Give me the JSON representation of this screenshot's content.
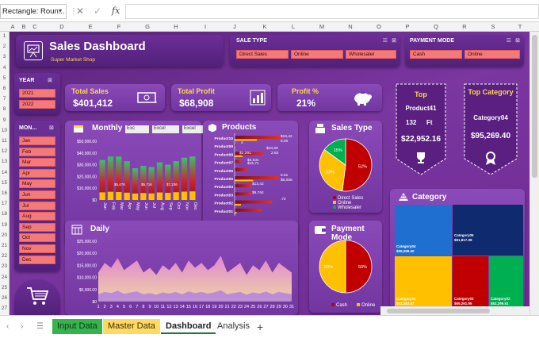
{
  "formula_bar": {
    "name_box": "Rectangle: Roun...",
    "fx": "fx",
    "cancel": "✕",
    "enter": "✓"
  },
  "columns": [
    "A",
    "B",
    "C",
    "D",
    "E",
    "F",
    "G",
    "H",
    "I",
    "J",
    "K",
    "L",
    "M",
    "N",
    "O",
    "P",
    "Q",
    "R",
    "S",
    "T"
  ],
  "rows": [
    "1",
    "2",
    "3",
    "4",
    "5",
    "6",
    "7",
    "8",
    "9",
    "10",
    "11",
    "12",
    "13",
    "14",
    "15",
    "16",
    "17",
    "18",
    "19",
    "20",
    "21",
    "22",
    "23",
    "24",
    "25",
    "26",
    "27"
  ],
  "header": {
    "title": "Sales Dashboard",
    "subtitle": "Super Market Shop"
  },
  "sale_type": {
    "title": "SALE TYPE",
    "items": [
      "Direct Sales",
      "Online",
      "Wholesaler"
    ]
  },
  "payment_mode_slicer": {
    "title": "PAYMENT MODE",
    "items": [
      "Cash",
      "Online"
    ]
  },
  "year": {
    "title": "YEAR",
    "items": [
      "2021",
      "2022"
    ]
  },
  "month": {
    "title": "MON...",
    "items": [
      "Jan",
      "Feb",
      "Mar",
      "Apr",
      "May",
      "Jun",
      "Jul",
      "Aug",
      "Sep",
      "Oct",
      "Nov",
      "Dec"
    ]
  },
  "kpis": {
    "total_sales": {
      "label": "Total Sales",
      "value": "$401,412"
    },
    "total_profit": {
      "label": "Total Profit",
      "value": "$68,908"
    },
    "profit_pct": {
      "label": "Profit %",
      "value": "21%"
    }
  },
  "top_product": {
    "title": "Top",
    "name": "Product41",
    "qty": "132",
    "unit": "Ft",
    "value": "$22,952.16"
  },
  "top_category": {
    "title": "Top Category",
    "name": "Category04",
    "value": "$95,269.40"
  },
  "monthly": {
    "title": "Monthly",
    "tabs": [
      "Exc",
      "Excel",
      "Excel"
    ]
  },
  "products": {
    "title": "Products"
  },
  "sales_type": {
    "title": "Sales Type"
  },
  "payment_mode": {
    "title": "Payment Mode"
  },
  "daily": {
    "title": "Daily"
  },
  "category": {
    "title": "Category"
  },
  "tabs": {
    "input": "Input Data",
    "master": "Master Data",
    "dashboard": "Dashboard",
    "analysis": "Analysis",
    "add": "+"
  },
  "chart_data": [
    {
      "type": "bar",
      "title": "Monthly",
      "categories": [
        "Jan",
        "Feb",
        "Mar",
        "Apr",
        "May",
        "Jun",
        "Jul",
        "Aug",
        "Sep",
        "Oct",
        "Nov",
        "Dec"
      ],
      "ylim": [
        0,
        50000
      ],
      "yticks": [
        "$0",
        "$10,000.00",
        "$20,000.00",
        "$30,000.00",
        "$40,000.00",
        "$50,000.00"
      ],
      "series": [
        {
          "name": "Sales",
          "values": [
            34000,
            37000,
            37000,
            33000,
            27000,
            29000,
            28000,
            32000,
            30000,
            33000,
            36000,
            37000
          ]
        },
        {
          "name": "Profit",
          "values": [
            6500,
            7000,
            6800,
            6200,
            5500,
            5900,
            5600,
            6400,
            6100,
            6600,
            7100,
            7300
          ]
        }
      ],
      "data_labels": [
        "$5,476",
        "$5,716",
        "$7,236"
      ]
    },
    {
      "type": "bar",
      "title": "Products",
      "orientation": "horizontal",
      "categories": [
        "Product10",
        "Product09",
        "Product08",
        "Product07",
        "Product06",
        "Product05",
        "Product04",
        "Product03",
        "Product02",
        "Product01"
      ],
      "series": [
        {
          "name": "Sales",
          "values": [
            16420,
            600,
            10500,
            2291,
            4531,
            15710,
            6056,
            6000,
            13420,
            9764
          ]
        },
        {
          "name": "Profit",
          "values": [
            8000,
            4,
            2820,
            0,
            0,
            6610,
            0,
            0,
            2270,
            720
          ]
        }
      ],
      "data_labels": [
        "$16,42",
        "8.00",
        "4",
        "$10,50",
        "2.82",
        "$2,291",
        "$4,531",
        "$15,71",
        "6.61",
        "$6,056",
        "$13,42",
        "$9,764",
        ".72"
      ]
    },
    {
      "type": "pie",
      "title": "Sales Type",
      "categories": [
        "Direct Sales",
        "Online",
        "Wholesaler"
      ],
      "values": [
        52,
        33,
        15
      ],
      "labels": [
        "52%",
        "33%",
        "15%"
      ],
      "colors": [
        "#c00000",
        "#ffc000",
        "#00b050"
      ]
    },
    {
      "type": "pie",
      "title": "Payment Mode",
      "categories": [
        "Cash",
        "Online"
      ],
      "values": [
        50,
        50
      ],
      "labels": [
        "50%",
        "50%"
      ],
      "colors": [
        "#c00000",
        "#ffc000"
      ]
    },
    {
      "type": "area",
      "title": "Daily",
      "x": [
        1,
        2,
        3,
        4,
        5,
        6,
        7,
        8,
        9,
        10,
        11,
        12,
        13,
        14,
        15,
        16,
        17,
        18,
        19,
        20,
        21,
        22,
        23,
        24,
        25,
        26,
        27,
        28,
        29,
        30,
        31
      ],
      "ylim": [
        0,
        25000
      ],
      "yticks": [
        "$0",
        "$5,000.00",
        "$10,000.00",
        "$15,000.00",
        "$20,000.00",
        "$25,000.00"
      ],
      "series": [
        {
          "name": "Sales",
          "values": [
            12000,
            16000,
            14000,
            18000,
            13000,
            15000,
            17000,
            12000,
            14000,
            11000,
            15000,
            13000,
            16000,
            12000,
            17000,
            14000,
            16000,
            13000,
            15000,
            19000,
            12000,
            14000,
            16000,
            11000,
            15000,
            13000,
            17000,
            12000,
            16000,
            14000,
            12000
          ]
        },
        {
          "name": "Profit",
          "values": [
            3000,
            4000,
            3500,
            4500,
            3200,
            3800,
            4200,
            3000,
            3500,
            2800,
            3800,
            3300,
            4000,
            3000,
            4200,
            3500,
            4000,
            3300,
            3800,
            4700,
            3000,
            3500,
            4000,
            2800,
            3800,
            3300,
            4200,
            3000,
            4000,
            3500,
            3000
          ]
        }
      ]
    },
    {
      "type": "heatmap",
      "title": "Category",
      "categories": [
        "Category04",
        "Category05",
        "Category01",
        "Category03",
        "Category02"
      ],
      "values": [
        95269.4,
        91917.39,
        93263.67,
        69261.95,
        52299.51
      ],
      "labels": [
        "$95,269.40",
        "$91,917.39",
        "$93,263.67",
        "$69,261.95",
        "$52,299.51"
      ],
      "colors": [
        "#1f6fd1",
        "#0f2a6e",
        "#ffc000",
        "#c00000",
        "#00b050"
      ]
    }
  ]
}
